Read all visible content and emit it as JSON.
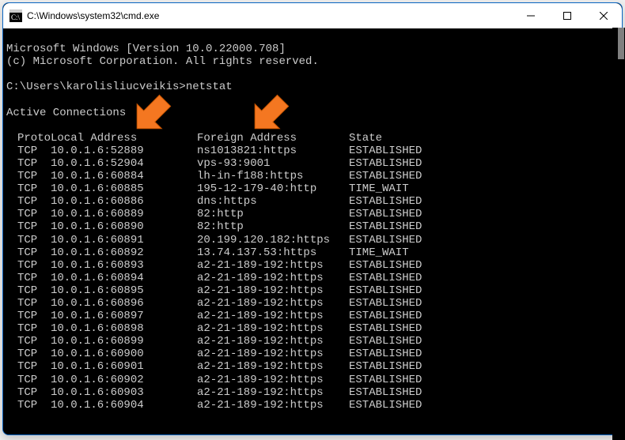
{
  "window": {
    "title": "C:\\Windows\\system32\\cmd.exe"
  },
  "banner": {
    "line1": "Microsoft Windows [Version 10.0.22000.708]",
    "line2": "(c) Microsoft Corporation. All rights reserved."
  },
  "prompt": {
    "path": "C:\\Users\\karolisliucveikis>",
    "command": "netstat"
  },
  "section_title": "Active Connections",
  "headers": {
    "proto": "Proto",
    "local": "Local Address",
    "foreign": "Foreign Address",
    "state": "State"
  },
  "rows": [
    {
      "proto": "TCP",
      "local": "10.0.1.6:52889",
      "foreign": "ns1013821:https",
      "state": "ESTABLISHED"
    },
    {
      "proto": "TCP",
      "local": "10.0.1.6:52904",
      "foreign": "vps-93:9001",
      "state": "ESTABLISHED"
    },
    {
      "proto": "TCP",
      "local": "10.0.1.6:60884",
      "foreign": "lh-in-f188:https",
      "state": "ESTABLISHED"
    },
    {
      "proto": "TCP",
      "local": "10.0.1.6:60885",
      "foreign": "195-12-179-40:http",
      "state": "TIME_WAIT"
    },
    {
      "proto": "TCP",
      "local": "10.0.1.6:60886",
      "foreign": "dns:https",
      "state": "ESTABLISHED"
    },
    {
      "proto": "TCP",
      "local": "10.0.1.6:60889",
      "foreign": "82:http",
      "state": "ESTABLISHED"
    },
    {
      "proto": "TCP",
      "local": "10.0.1.6:60890",
      "foreign": "82:http",
      "state": "ESTABLISHED"
    },
    {
      "proto": "TCP",
      "local": "10.0.1.6:60891",
      "foreign": "20.199.120.182:https",
      "state": "ESTABLISHED"
    },
    {
      "proto": "TCP",
      "local": "10.0.1.6:60892",
      "foreign": "13.74.137.53:https",
      "state": "TIME_WAIT"
    },
    {
      "proto": "TCP",
      "local": "10.0.1.6:60893",
      "foreign": "a2-21-189-192:https",
      "state": "ESTABLISHED"
    },
    {
      "proto": "TCP",
      "local": "10.0.1.6:60894",
      "foreign": "a2-21-189-192:https",
      "state": "ESTABLISHED"
    },
    {
      "proto": "TCP",
      "local": "10.0.1.6:60895",
      "foreign": "a2-21-189-192:https",
      "state": "ESTABLISHED"
    },
    {
      "proto": "TCP",
      "local": "10.0.1.6:60896",
      "foreign": "a2-21-189-192:https",
      "state": "ESTABLISHED"
    },
    {
      "proto": "TCP",
      "local": "10.0.1.6:60897",
      "foreign": "a2-21-189-192:https",
      "state": "ESTABLISHED"
    },
    {
      "proto": "TCP",
      "local": "10.0.1.6:60898",
      "foreign": "a2-21-189-192:https",
      "state": "ESTABLISHED"
    },
    {
      "proto": "TCP",
      "local": "10.0.1.6:60899",
      "foreign": "a2-21-189-192:https",
      "state": "ESTABLISHED"
    },
    {
      "proto": "TCP",
      "local": "10.0.1.6:60900",
      "foreign": "a2-21-189-192:https",
      "state": "ESTABLISHED"
    },
    {
      "proto": "TCP",
      "local": "10.0.1.6:60901",
      "foreign": "a2-21-189-192:https",
      "state": "ESTABLISHED"
    },
    {
      "proto": "TCP",
      "local": "10.0.1.6:60902",
      "foreign": "a2-21-189-192:https",
      "state": "ESTABLISHED"
    },
    {
      "proto": "TCP",
      "local": "10.0.1.6:60903",
      "foreign": "a2-21-189-192:https",
      "state": "ESTABLISHED"
    },
    {
      "proto": "TCP",
      "local": "10.0.1.6:60904",
      "foreign": "a2-21-189-192:https",
      "state": "ESTABLISHED"
    }
  ],
  "annotation": {
    "arrow_color": "#f47721"
  }
}
